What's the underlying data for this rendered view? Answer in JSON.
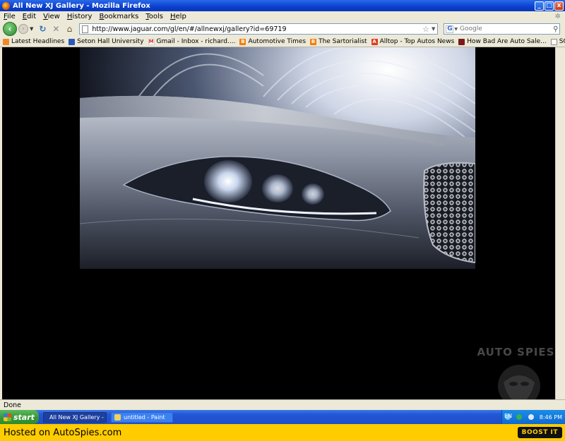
{
  "window": {
    "title": "All New XJ Gallery - Mozilla Firefox",
    "minimize_label": "_",
    "maximize_label": "□",
    "close_label": "x"
  },
  "menu": {
    "items": [
      "File",
      "Edit",
      "View",
      "History",
      "Bookmarks",
      "Tools",
      "Help"
    ]
  },
  "nav": {
    "back_label": "‹",
    "forward_label": "›",
    "url": "http://www.jaguar.com/gl/en/#/allnewxj/gallery?id=69719",
    "search_placeholder": "Google",
    "search_engine": "G"
  },
  "bookmarks": [
    {
      "label": "Latest Headlines",
      "icon": "rss-icon",
      "color": "#f08a24"
    },
    {
      "label": "Seton Hall University",
      "icon": "seton-hall-icon",
      "color": "#2a5ab8"
    },
    {
      "label": "Gmail - Inbox - richard....",
      "icon": "gmail-icon",
      "color": "#d93025"
    },
    {
      "label": "Automotive Times",
      "icon": "blogger-icon",
      "color": "#f57d00"
    },
    {
      "label": "The Sartorialist",
      "icon": "blogger-icon",
      "color": "#f57d00"
    },
    {
      "label": "Alltop - Top Autos News",
      "icon": "alltop-icon",
      "color": "#e03a1e"
    },
    {
      "label": "How Bad Are Auto Sale...",
      "icon": "news-icon",
      "color": "#7a1a1a"
    },
    {
      "label": "SCOUTING NY - www.s...",
      "icon": "page-icon",
      "color": "#ffffff"
    }
  ],
  "content": {
    "watermark": "AUTO SPIES"
  },
  "status": {
    "text": "Done"
  },
  "taskbar": {
    "start_label": "start",
    "tasks": [
      {
        "label": "All New XJ Gallery - M...",
        "active": true
      },
      {
        "label": "untitled - Paint",
        "active": false
      }
    ],
    "language": "EN",
    "clock": "8:46 PM"
  },
  "footer": {
    "hosted_text": "Hosted on AutoSpies.com",
    "boost_label": "BOOST IT"
  },
  "colors": {
    "titlebar": "#0a3fd0",
    "chrome": "#ece9d8",
    "footer": "#ffcc00",
    "start": "#3a9a3a"
  }
}
